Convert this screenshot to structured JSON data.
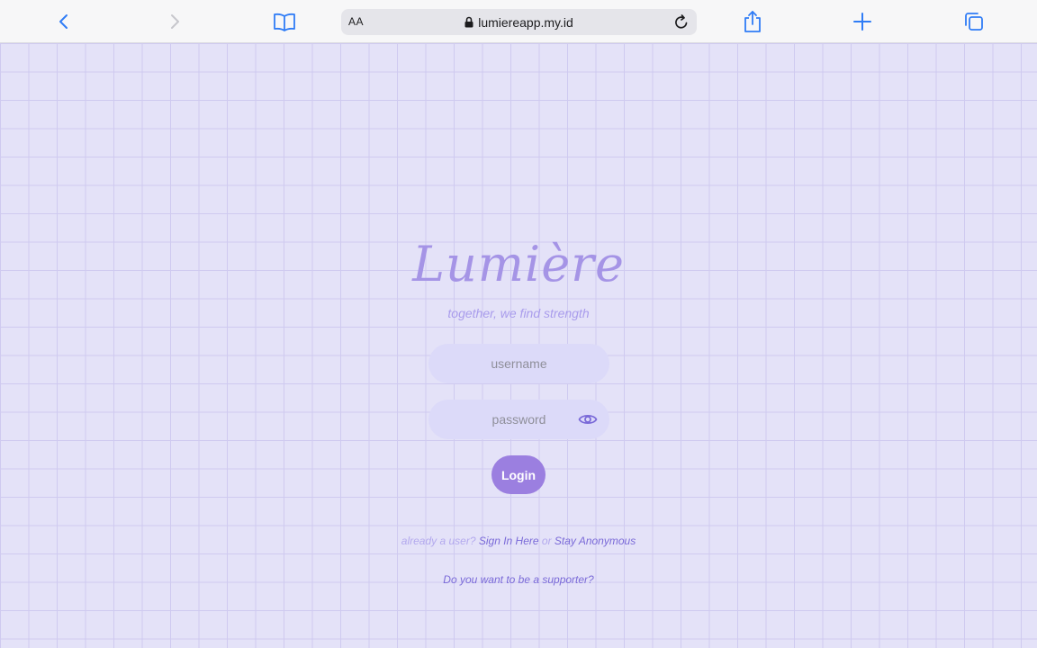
{
  "browser": {
    "text_size_label": "AA",
    "url": "lumiereapp.my.id",
    "accent_color": "#2f7cf6"
  },
  "page": {
    "logo": "Lumière",
    "tagline": "together, we find strength",
    "username_placeholder": "username",
    "password_placeholder": "password",
    "login_label": "Login",
    "already_user_text": "already a user?",
    "sign_in_link": "Sign In Here",
    "or_text": "or",
    "anonymous_link": "Stay Anonymous",
    "supporter_link": "Do you want to be a supporter?",
    "colors": {
      "background": "#e4e2f8",
      "grid_line": "#cfcaf0",
      "logo": "#a594e6",
      "button": "#9b7fe0",
      "link": "#7a6ad8"
    }
  }
}
